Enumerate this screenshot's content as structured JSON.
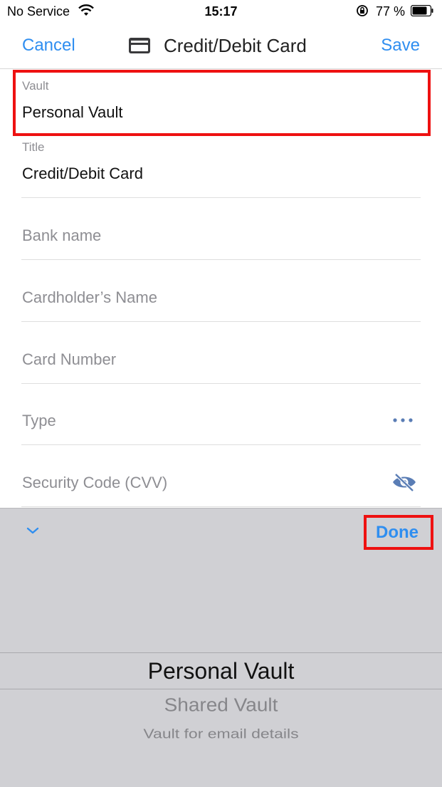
{
  "status_bar": {
    "carrier": "No Service",
    "time": "15:17",
    "battery_percent": "77 %",
    "battery_level": 0.77,
    "icons": [
      "wifi-icon",
      "orientation-lock-icon",
      "battery-icon"
    ]
  },
  "nav": {
    "cancel_label": "Cancel",
    "title": "Credit/Debit Card",
    "title_icon": "credit-card-icon",
    "save_label": "Save"
  },
  "form": {
    "vault": {
      "label": "Vault",
      "value": "Personal Vault"
    },
    "title": {
      "label": "Title",
      "value": "Credit/Debit Card"
    },
    "bank_name": {
      "placeholder": "Bank name"
    },
    "cardholder": {
      "placeholder": "Cardholder’s Name"
    },
    "card_number": {
      "placeholder": "Card Number"
    },
    "type": {
      "placeholder": "Type",
      "icon": "more-icon"
    },
    "security_code": {
      "placeholder": "Security Code (CVV)",
      "icon": "eye-slash-icon"
    }
  },
  "toolbar": {
    "collapse_icon": "chevron-down-icon",
    "done_label": "Done"
  },
  "picker": {
    "selected": "Personal Vault",
    "options": [
      "Personal Vault",
      "Shared Vault",
      "Vault for email details"
    ]
  },
  "colors": {
    "accent": "#2f8ef0",
    "highlight": "#ee1111",
    "keyboard_bg": "#d0d0d4",
    "placeholder": "#8e8e93"
  }
}
